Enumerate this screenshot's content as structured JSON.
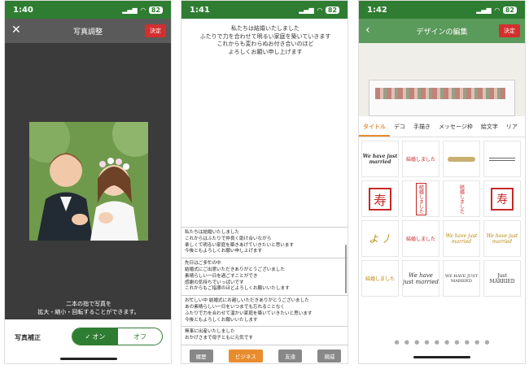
{
  "screen1": {
    "time": "1:40",
    "battery": "82",
    "title": "写真調整",
    "close_label": "✕",
    "confirm_label": "決定",
    "hint_line1": "二本の指で写真を",
    "hint_line2": "拡大・縮小・回転することができます。",
    "correction_label": "写真補正",
    "toggle_on": "オン",
    "toggle_off": "オフ"
  },
  "screen2": {
    "time": "1:41",
    "battery": "82",
    "message_lines": [
      "私たちは結婚いたしました",
      "ふたりで力を合わせて明るい家庭を築いていきます",
      "これからも変わらぬお付き合いのほど",
      "よろしくお願い申し上げます"
    ],
    "templates": [
      [
        "私たちは結婚いたしました",
        "これからはふたりで仲良く助け合いながら",
        "楽しくて明るい家庭を築きあげていきたいと思います",
        "今後ともよろしくお願い申し上げます"
      ],
      [
        "先日はご多忙の中",
        "結婚式にご出席いただきありがとうございました",
        "素晴らしい一日を過ごすことができ",
        "感謝の気持ちでいっぱいです",
        "これからもご指導のほどよろしくお願いいたします"
      ],
      [
        "お忙しい中 結婚式にお越しいただきありがとうございました",
        "あの素晴らしい一日をいつまでも忘れることなく",
        "ふたりで力を合わせて温かい家庭を築いていきたいと思います",
        "今後ともよろしくお願いいたします"
      ],
      [
        "無事に出産いたしました",
        "おかげさまで母子ともに元気です"
      ]
    ],
    "tabs": [
      "履歴",
      "ビジネス",
      "友達",
      "親戚"
    ],
    "active_tab": "ビジネス"
  },
  "screen3": {
    "time": "1:42",
    "battery": "82",
    "title": "デザインの編集",
    "back_label": "‹",
    "confirm_label": "決定",
    "categories": [
      "タイトル",
      "デコ",
      "手描き",
      "メッセージ枠",
      "絵文字",
      "リア"
    ],
    "active_category": "タイトル",
    "stickers": [
      "We have just married",
      "結婚しました",
      "",
      "",
      "寿",
      "結婚しました",
      "結婚しました",
      "寿",
      "よ 丿",
      "結婚しました",
      "We have just married",
      "We have just married",
      "結婚しました",
      "We have just married",
      "WE HAVE JUST MARRIED",
      "Just MARRIED"
    ],
    "pager": "● ● ● ● ● ● ● ● ● ●"
  },
  "colors": {
    "green": "#2e7d32",
    "orange": "#e98c2e",
    "red": "#d32f2f"
  }
}
